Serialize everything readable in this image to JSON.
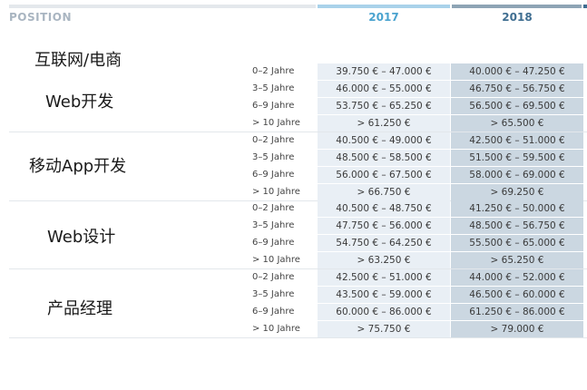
{
  "header": {
    "position_label": "POSITION",
    "year1": "2017",
    "year2": "2018"
  },
  "sections": [
    {
      "titles": [
        "互联网/电商",
        "Web开发"
      ],
      "rows": [
        {
          "label": "0–2 Jahre",
          "v2017": "39.750 €  –  47.000 €",
          "v2018": "40.000 €  –  47.250 €"
        },
        {
          "label": "3–5 Jahre",
          "v2017": "46.000 €  –  55.000 €",
          "v2018": "46.750 €  –  56.750 €"
        },
        {
          "label": "6–9 Jahre",
          "v2017": "53.750 €  –  65.250 €",
          "v2018": "56.500 €  –  69.500 €"
        },
        {
          "label": "> 10 Jahre",
          "v2017": "> 61.250 €",
          "v2018": "> 65.500 €"
        }
      ]
    },
    {
      "titles": [
        "移动App开发"
      ],
      "rows": [
        {
          "label": "0–2 Jahre",
          "v2017": "40.500 €  –  49.000 €",
          "v2018": "42.500 €  –  51.000 €"
        },
        {
          "label": "3–5 Jahre",
          "v2017": "48.500 €  –  58.500 €",
          "v2018": "51.500 €  –  59.500 €"
        },
        {
          "label": "6–9 Jahre",
          "v2017": "56.000 €  –  67.500 €",
          "v2018": "58.000 €  –  69.000 €"
        },
        {
          "label": "> 10 Jahre",
          "v2017": "> 66.750 €",
          "v2018": "> 69.250 €"
        }
      ]
    },
    {
      "titles": [
        "Web设计"
      ],
      "rows": [
        {
          "label": "0–2 Jahre",
          "v2017": "40.500 €  –  48.750 €",
          "v2018": "41.250 €  –  50.000 €"
        },
        {
          "label": "3–5 Jahre",
          "v2017": "47.750 €  –  56.000 €",
          "v2018": "48.500 €  –  56.750 €"
        },
        {
          "label": "6–9 Jahre",
          "v2017": "54.750 €  –  64.250 €",
          "v2018": "55.500 €  –  65.000 €"
        },
        {
          "label": "> 10 Jahre",
          "v2017": "> 63.250 €",
          "v2018": "> 65.250 €"
        }
      ]
    },
    {
      "titles": [
        "产品经理"
      ],
      "rows": [
        {
          "label": "0–2 Jahre",
          "v2017": "42.500 €  –  51.000 €",
          "v2018": "44.000 €  –  52.000 €"
        },
        {
          "label": "3–5 Jahre",
          "v2017": "43.500 €  –  59.000 €",
          "v2018": "46.500 €  –  60.000 €"
        },
        {
          "label": "6–9 Jahre",
          "v2017": "60.000 €  –  86.000 €",
          "v2018": "61.250 €  –  86.000 €"
        },
        {
          "label": "> 10 Jahre",
          "v2017": "> 75.750 €",
          "v2018": "> 79.000 €"
        }
      ]
    }
  ]
}
